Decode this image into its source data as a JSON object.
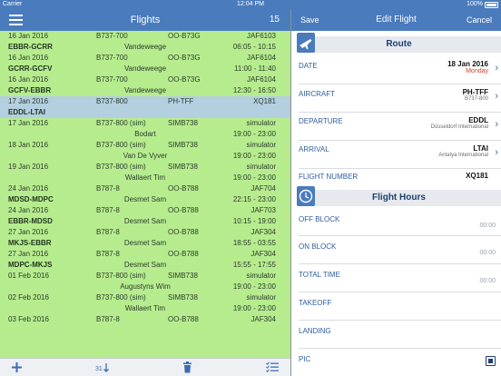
{
  "status_bar": {
    "carrier": "Carrier",
    "time": "12:04 PM",
    "battery": "100%"
  },
  "flights": {
    "title": "Flights",
    "count": "15",
    "rows": [
      {
        "kind": "info",
        "date": "16 Jan 2016",
        "type": "B737-700",
        "reg": "OO-B73G",
        "fno": "JAF6103"
      },
      {
        "kind": "route",
        "route": "EBBR-GCRR",
        "pic": "Vandeweege",
        "times": "06:05 - 10:15"
      },
      {
        "kind": "info",
        "date": "16 Jan 2016",
        "type": "B737-700",
        "reg": "OO-B73G",
        "fno": "JAF6104"
      },
      {
        "kind": "route",
        "route": "GCRR-GCFV",
        "pic": "Vandeweege",
        "times": "11:00 - 11:40"
      },
      {
        "kind": "info",
        "date": "16 Jan 2016",
        "type": "B737-700",
        "reg": "OO-B73G",
        "fno": "JAF6104"
      },
      {
        "kind": "route",
        "route": "GCFV-EBBR",
        "pic": "Vandeweege",
        "times": "12:30 - 16:50"
      },
      {
        "kind": "info",
        "selected": true,
        "date": "17 Jan 2016",
        "type": "B737-800",
        "reg": "PH-TFF",
        "fno": "XQ181"
      },
      {
        "kind": "route",
        "selected": true,
        "route": "EDDL-LTAI",
        "pic": "",
        "times": ""
      },
      {
        "kind": "info",
        "date": "17 Jan 2016",
        "type": "B737-800 (sim)",
        "reg": "SIMB738",
        "fno": "simulator"
      },
      {
        "kind": "route",
        "route": "",
        "pic": "Bodart",
        "times": "19:00 - 23:00"
      },
      {
        "kind": "info",
        "date": "18 Jan 2016",
        "type": "B737-800 (sim)",
        "reg": "SIMB738",
        "fno": "simulator"
      },
      {
        "kind": "route",
        "route": "",
        "pic": "Van De Vyver",
        "times": "19:00 - 23:00"
      },
      {
        "kind": "info",
        "date": "19 Jan 2016",
        "type": "B737-800 (sim)",
        "reg": "SIMB738",
        "fno": "simulator"
      },
      {
        "kind": "route",
        "route": "",
        "pic": "Wallaert Tim",
        "times": "19:00 - 23:00"
      },
      {
        "kind": "info",
        "date": "24 Jan 2016",
        "type": "B787-8",
        "reg": "OO-B788",
        "fno": "JAF704"
      },
      {
        "kind": "route",
        "route": "MDSD-MDPC",
        "pic": "Desmet Sam",
        "times": "22:15 - 23:00"
      },
      {
        "kind": "info",
        "date": "24 Jan 2016",
        "type": "B787-8",
        "reg": "OO-B788",
        "fno": "JAF703"
      },
      {
        "kind": "route",
        "route": "EBBR-MDSD",
        "pic": "Desmet Sam",
        "times": "10:15 - 19:00"
      },
      {
        "kind": "info",
        "date": "27 Jan 2016",
        "type": "B787-8",
        "reg": "OO-B788",
        "fno": "JAF304"
      },
      {
        "kind": "route",
        "route": "MKJS-EBBR",
        "pic": "Desmet Sam",
        "times": "18:55 - 03:55"
      },
      {
        "kind": "info",
        "date": "27 Jan 2016",
        "type": "B787-8",
        "reg": "OO-B788",
        "fno": "JAF304"
      },
      {
        "kind": "route",
        "route": "MDPC-MKJS",
        "pic": "Desmet Sam",
        "times": "15:55 - 17:55"
      },
      {
        "kind": "info",
        "date": "01 Feb 2016",
        "type": "B737-800 (sim)",
        "reg": "SIMB738",
        "fno": "simulator"
      },
      {
        "kind": "route",
        "route": "",
        "pic": "Augustyns Wim",
        "times": "19:00 - 23:00"
      },
      {
        "kind": "info",
        "date": "02 Feb 2016",
        "type": "B737-800 (sim)",
        "reg": "SIMB738",
        "fno": "simulator"
      },
      {
        "kind": "route",
        "route": "",
        "pic": "Wallaert Tim",
        "times": "19:00 - 23:00"
      },
      {
        "kind": "info",
        "date": "03 Feb 2016",
        "type": "B787-8",
        "reg": "OO-B788",
        "fno": "JAF304"
      }
    ]
  },
  "toolbar": {
    "icons": [
      "plus-icon",
      "calendar-sort-icon",
      "trash-icon",
      "list-check-icon"
    ],
    "calendar_badge": "31"
  },
  "edit": {
    "title": "Edit Flight",
    "save_label": "Save",
    "cancel_label": "Cancel",
    "route_header": "Route",
    "date": {
      "label": "DATE",
      "value": "18 Jan 2016",
      "sub": "Monday"
    },
    "aircraft": {
      "label": "AIRCRAFT",
      "value": "PH-TFF",
      "sub": "B737-800"
    },
    "departure": {
      "label": "DEPARTURE",
      "value": "EDDL",
      "sub": "Düsseldorf International"
    },
    "arrival": {
      "label": "ARRIVAL",
      "value": "LTAI",
      "sub": "Antalya International"
    },
    "flight_number": {
      "label": "FLIGHT NUMBER",
      "value": "XQ181"
    },
    "hours_header": "Flight Hours",
    "off_block": {
      "label": "OFF BLOCK",
      "value": "00:00"
    },
    "on_block": {
      "label": "ON BLOCK",
      "value": "00:00"
    },
    "total_time": {
      "label": "TOTAL TIME",
      "value": "00:00"
    },
    "takeoff": {
      "label": "TAKEOFF"
    },
    "landing": {
      "label": "LANDING"
    },
    "pic": {
      "label": "PIC",
      "checked": true
    }
  },
  "colors": {
    "header_blue": "#4a7bbd",
    "list_green": "#b6ec8e",
    "selected_row": "#b3cfe0",
    "accent_red": "#d63a2a"
  }
}
